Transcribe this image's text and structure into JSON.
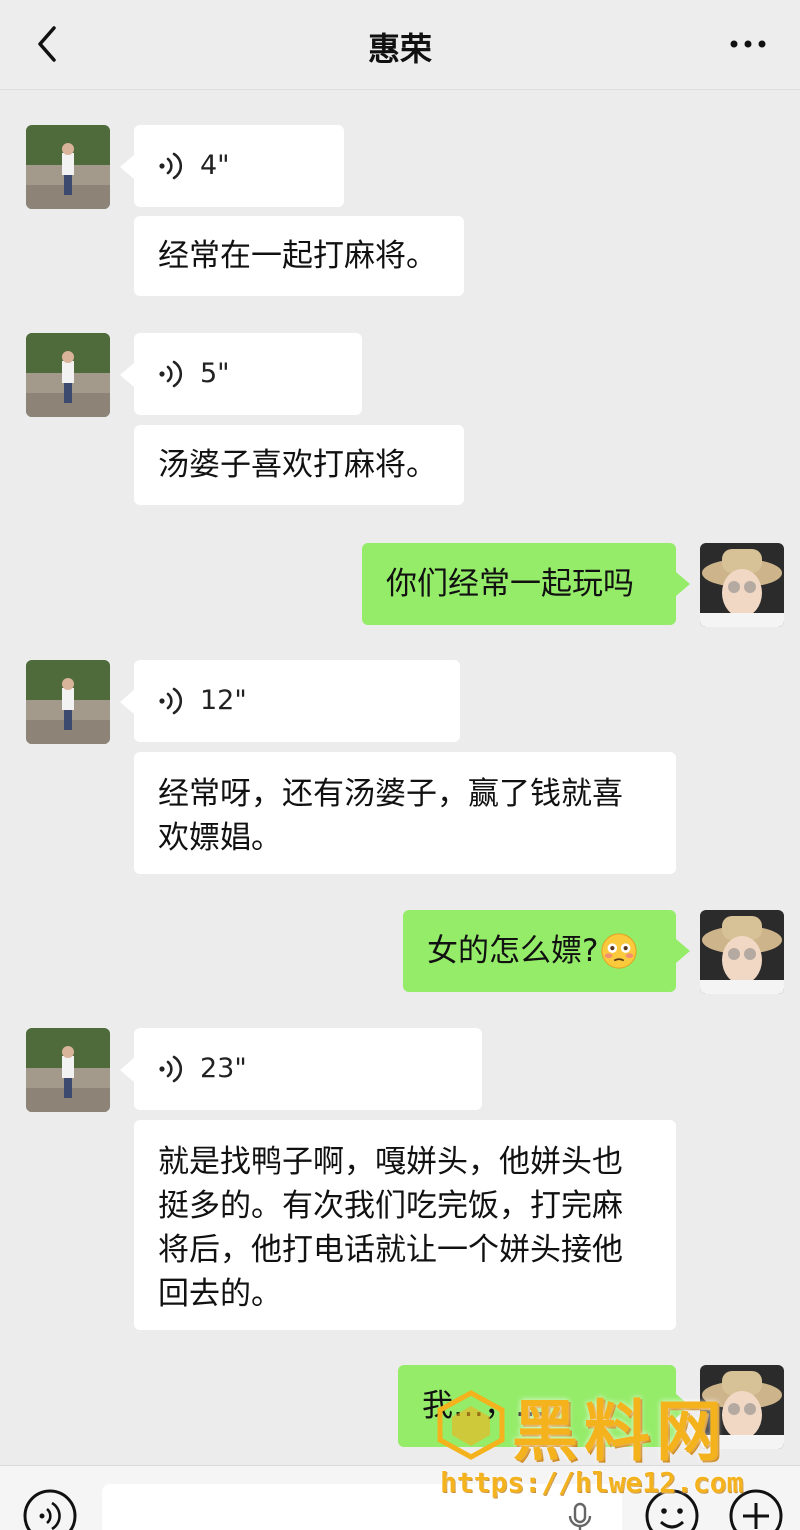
{
  "header": {
    "title": "惠荣"
  },
  "messages": [
    {
      "side": "in",
      "type": "voice",
      "duration": "4\""
    },
    {
      "side": "in",
      "type": "text",
      "text": "经常在一起打麻将。"
    },
    {
      "side": "in",
      "type": "voice",
      "duration": "5\""
    },
    {
      "side": "in",
      "type": "text",
      "text": "汤婆子喜欢打麻将。"
    },
    {
      "side": "out",
      "type": "text",
      "text": "你们经常一起玩吗"
    },
    {
      "side": "in",
      "type": "voice",
      "duration": "12\""
    },
    {
      "side": "in",
      "type": "text",
      "lines": [
        "经常呀，还有汤婆子，赢了钱就喜",
        "欢嫖娼。"
      ]
    },
    {
      "side": "out",
      "type": "text",
      "text": "女的怎么嫖?"
    },
    {
      "side": "in",
      "type": "voice",
      "duration": "23\""
    },
    {
      "side": "in",
      "type": "text",
      "lines": [
        "就是找鸭子啊，嘎姘头，他姘头也",
        "挺多的。有次我们吃完饭，打完麻",
        "将后，他打电话就让一个姘头接他",
        "回去的。"
      ]
    },
    {
      "side": "out",
      "type": "text",
      "text": "我…，…"
    }
  ],
  "icons": {
    "back": "chevron-left-icon",
    "more": "more-dots-icon",
    "voice": "voice-wave-icon",
    "emoji_reaction": "flushed-face-emoji",
    "voice_toggle": "voice-toggle-icon",
    "mic": "microphone-icon",
    "emoji_button": "smiley-icon",
    "plus": "plus-icon"
  },
  "colors": {
    "background": "#ececec",
    "incoming_bubble": "#ffffff",
    "outgoing_bubble": "#95ec69"
  },
  "watermark": {
    "title": "黑料网",
    "url": "https://hlwe12.com"
  }
}
